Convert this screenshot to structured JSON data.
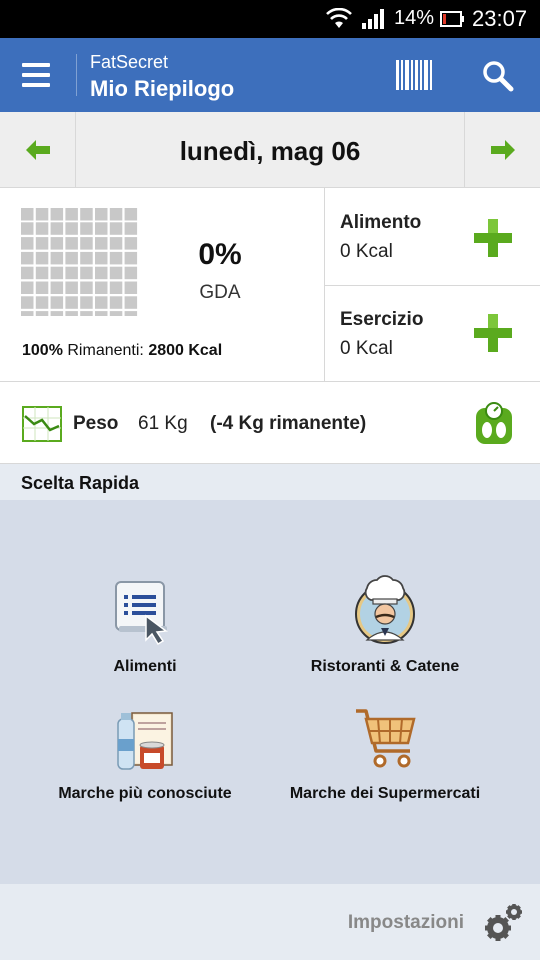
{
  "status_bar": {
    "battery_percent": "14%",
    "time": "23:07"
  },
  "app_bar": {
    "brand": "FatSecret",
    "title": "Mio Riepilogo"
  },
  "date_nav": {
    "date": "lunedì, mag 06"
  },
  "summary": {
    "percent": "0%",
    "percent_label": "GDA",
    "remaining_percent": "100%",
    "remaining_label": "Rimanenti:",
    "remaining_kcal": "2800 Kcal",
    "food_label": "Alimento",
    "food_value": "0 Kcal",
    "exercise_label": "Esercizio",
    "exercise_value": "0 Kcal"
  },
  "weight": {
    "label": "Peso",
    "value": "61 Kg",
    "remaining": "(-4 Kg rimanente)"
  },
  "quick_choice": {
    "heading": "Scelta Rapida",
    "items": [
      {
        "label": "Alimenti",
        "icon": "food-list-icon"
      },
      {
        "label": "Ristoranti & Catene",
        "icon": "chef-icon"
      },
      {
        "label": "Marche più conosciute",
        "icon": "brands-icon"
      },
      {
        "label": "Marche dei Supermercati",
        "icon": "shopping-cart-icon"
      }
    ]
  },
  "footer": {
    "settings_label": "Impostazioni"
  },
  "colors": {
    "app_bar": "#3d6fbc",
    "accent_green": "#5aaa1e",
    "quick_panel": "#d5dce8"
  }
}
